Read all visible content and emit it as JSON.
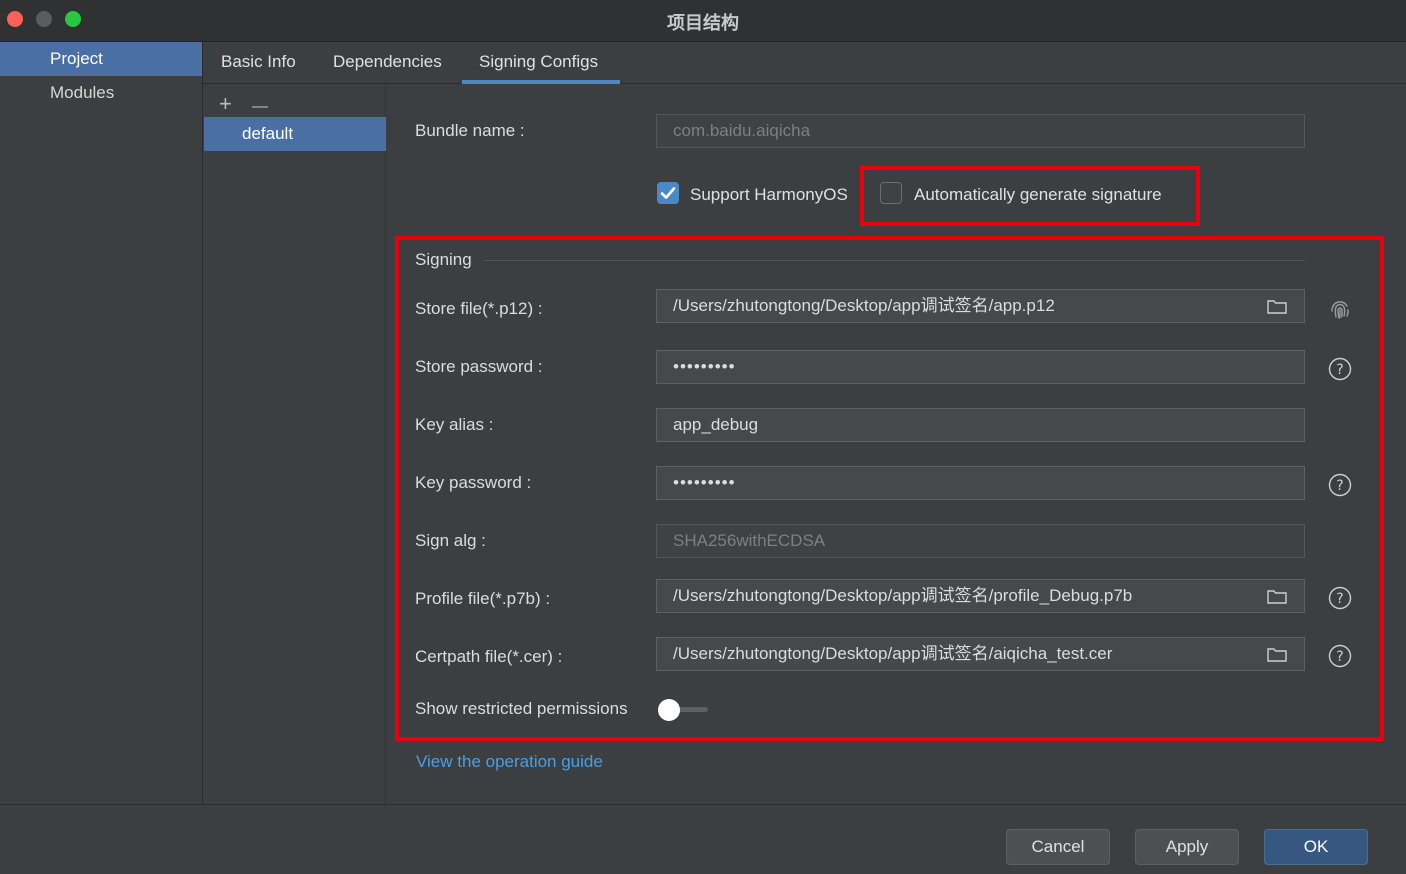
{
  "window": {
    "title": "项目结构"
  },
  "sidebar": {
    "items": [
      {
        "label": "Project"
      },
      {
        "label": "Modules"
      }
    ]
  },
  "tabs": [
    {
      "label": "Basic Info"
    },
    {
      "label": "Dependencies"
    },
    {
      "label": "Signing Configs"
    }
  ],
  "config_list": {
    "add_symbol": "+",
    "remove_symbol": "—",
    "items": [
      {
        "label": "default"
      }
    ]
  },
  "form": {
    "bundle_name": {
      "label": "Bundle name :",
      "value": "com.baidu.aiqicha"
    },
    "support_harmonyos": {
      "label": "Support HarmonyOS",
      "checked": true
    },
    "auto_generate": {
      "label": "Automatically generate signature",
      "checked": false
    },
    "signing_section": "Signing",
    "store_file": {
      "label": "Store file(*.p12) :",
      "value": "/Users/zhutongtong/Desktop/app调试签名/app.p12"
    },
    "store_password": {
      "label": "Store password :",
      "value": "•••••••••"
    },
    "key_alias": {
      "label": "Key alias :",
      "value": "app_debug"
    },
    "key_password": {
      "label": "Key password :",
      "value": "•••••••••"
    },
    "sign_alg": {
      "label": "Sign alg :",
      "value": "SHA256withECDSA"
    },
    "profile_file": {
      "label": "Profile file(*.p7b) :",
      "value": "/Users/zhutongtong/Desktop/app调试签名/profile_Debug.p7b"
    },
    "certpath_file": {
      "label": "Certpath file(*.cer) :",
      "value": "/Users/zhutongtong/Desktop/app调试签名/aiqicha_test.cer"
    },
    "show_restricted": {
      "label": "Show restricted permissions",
      "enabled": false
    }
  },
  "guide_link": "View the operation guide",
  "footer": {
    "cancel": "Cancel",
    "apply": "Apply",
    "ok": "OK"
  },
  "icons": {
    "folder": "folder-icon",
    "help": "help-icon",
    "fingerprint": "fingerprint-icon",
    "check": "check-icon"
  },
  "colors": {
    "accent": "#4a88c7",
    "highlight": "#e8000b",
    "link": "#4b9ee3",
    "selected": "#4a6fa5"
  }
}
